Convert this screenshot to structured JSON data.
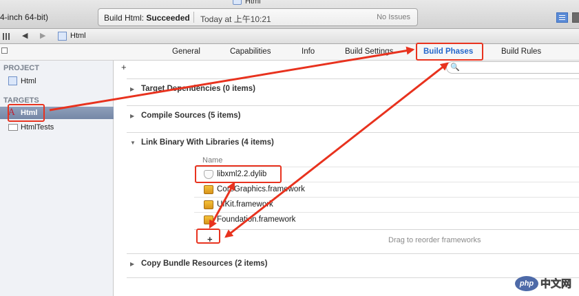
{
  "window": {
    "title": "Html"
  },
  "toolbar": {
    "scheme_text": "4-inch 64-bit)",
    "activity": {
      "status_prefix": "Build Html: ",
      "status_bold": "Succeeded",
      "time": "Today at 上午10:21",
      "issues": "No Issues"
    }
  },
  "jumpbar": {
    "file_label": "Html"
  },
  "tabs": [
    {
      "label": "General"
    },
    {
      "label": "Capabilities"
    },
    {
      "label": "Info"
    },
    {
      "label": "Build Settings"
    },
    {
      "label": "Build Phases",
      "active": true
    },
    {
      "label": "Build Rules"
    }
  ],
  "sidebar": {
    "project_header": "PROJECT",
    "project_item": "Html",
    "targets_header": "TARGETS",
    "targets": [
      {
        "label": "Html",
        "selected": true
      },
      {
        "label": "HtmlTests",
        "selected": false
      }
    ]
  },
  "main": {
    "add_symbol": "+",
    "phases": [
      {
        "title": "Target Dependencies (0 items)",
        "expanded": false
      },
      {
        "title": "Compile Sources (5 items)",
        "expanded": false
      },
      {
        "title": "Link Binary With Libraries (4 items)",
        "expanded": true
      },
      {
        "title": "Copy Bundle Resources (2 items)",
        "expanded": false
      }
    ],
    "libraries": {
      "column_header": "Name",
      "items": [
        {
          "name": "libxml2.2.dylib",
          "icon": "dylib-icon"
        },
        {
          "name": "CoreGraphics.framework",
          "icon": "framework-icon"
        },
        {
          "name": "UIKit.framework",
          "icon": "framework-icon"
        },
        {
          "name": "Foundation.framework",
          "icon": "framework-icon"
        }
      ],
      "add_symbol": "+",
      "hint": "Drag to reorder frameworks"
    }
  },
  "watermark": {
    "badge": "php",
    "text": "中文网"
  },
  "colors": {
    "accent": "#2266cc",
    "annotation": "#e8321e",
    "selection": "#7f91af"
  }
}
